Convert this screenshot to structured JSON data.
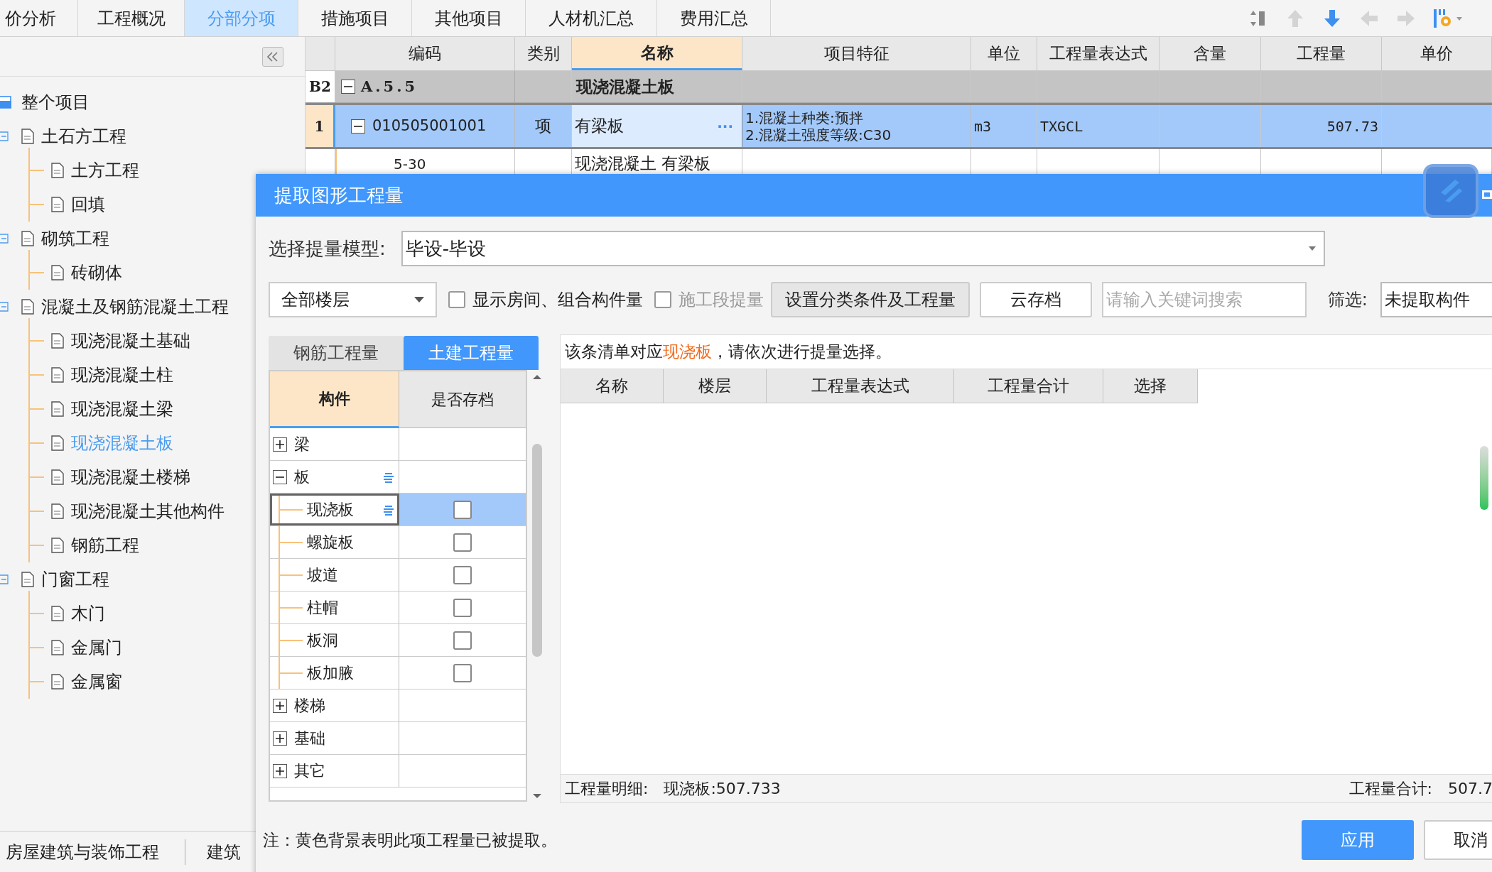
{
  "tabs": [
    {
      "label": "价分析",
      "selected": false
    },
    {
      "label": "工程概况",
      "selected": false
    },
    {
      "label": "分部分项",
      "selected": true
    },
    {
      "label": "措施项目",
      "selected": false
    },
    {
      "label": "其他项目",
      "selected": false
    },
    {
      "label": "人材机汇总",
      "selected": false
    },
    {
      "label": "费用汇总",
      "selected": false
    }
  ],
  "toolbar": [
    {
      "kind": "sort",
      "disabled": false
    },
    {
      "kind": "up",
      "disabled": true
    },
    {
      "kind": "down",
      "disabled": false
    },
    {
      "kind": "left",
      "disabled": true
    },
    {
      "kind": "right",
      "disabled": true
    },
    {
      "kind": "settings",
      "disabled": false
    }
  ],
  "tree": {
    "label": "整个项目",
    "selected": false,
    "children": [
      {
        "label": "土石方工程",
        "selected": false,
        "expanded": true,
        "children": [
          {
            "label": "土方工程",
            "selected": false
          },
          {
            "label": "回填",
            "selected": false
          }
        ]
      },
      {
        "label": "砌筑工程",
        "selected": false,
        "expanded": true,
        "children": [
          {
            "label": "砖砌体",
            "selected": false
          }
        ]
      },
      {
        "label": "混凝土及钢筋混凝土工程",
        "selected": false,
        "expanded": true,
        "children": [
          {
            "label": "现浇混凝土基础",
            "selected": false
          },
          {
            "label": "现浇混凝土柱",
            "selected": false
          },
          {
            "label": "现浇混凝土梁",
            "selected": false
          },
          {
            "label": "现浇混凝土板",
            "selected": true
          },
          {
            "label": "现浇混凝土楼梯",
            "selected": false
          },
          {
            "label": "现浇混凝土其他构件",
            "selected": false
          },
          {
            "label": "钢筋工程",
            "selected": false
          }
        ]
      },
      {
        "label": "门窗工程",
        "selected": false,
        "expanded": true,
        "children": [
          {
            "label": "木门",
            "selected": false
          },
          {
            "label": "金属门",
            "selected": false
          },
          {
            "label": "金属窗",
            "selected": false
          }
        ]
      }
    ]
  },
  "bottom_tabs": [
    "房屋建筑与装饰工程",
    "建筑"
  ],
  "grid": {
    "columns": [
      {
        "label": "编码",
        "selected": false
      },
      {
        "label": "类别",
        "selected": false
      },
      {
        "label": "名称",
        "selected": true
      },
      {
        "label": "项目特征",
        "selected": false
      },
      {
        "label": "单位",
        "selected": false
      },
      {
        "label": "工程量表达式",
        "selected": false
      },
      {
        "label": "含量",
        "selected": false
      },
      {
        "label": "工程量",
        "selected": false
      },
      {
        "label": "单价",
        "selected": false
      }
    ],
    "rows": [
      {
        "kind": "section",
        "index": "B2",
        "expanded": true,
        "code": "A.5.5",
        "name": "现浇混凝土板"
      },
      {
        "kind": "item",
        "index": "1",
        "expanded": true,
        "selected": true,
        "code": "010505001001",
        "type": "项",
        "name": "有梁板",
        "more": "···",
        "features": [
          "1.混凝土种类:预拌",
          "2.混凝土强度等级:C30"
        ],
        "unit": "m3",
        "expression": "TXGCL",
        "quantity": "507.73"
      },
      {
        "kind": "sub",
        "code": "5-30",
        "name": "现浇混凝土 有梁板"
      }
    ]
  },
  "dialog": {
    "title": "提取图形工程量",
    "model": {
      "label": "选择提量模型:",
      "value": "毕设-毕设"
    },
    "floor": {
      "value": "全部楼层"
    },
    "options": [
      {
        "label": "显示房间、组合构件量",
        "checked": false,
        "disabled": false
      },
      {
        "label": "施工段提量",
        "checked": false,
        "disabled": true
      }
    ],
    "buttons": [
      "设置分类条件及工程量",
      "云存档"
    ],
    "search": {
      "placeholder": "请输入关键词搜索"
    },
    "filter": {
      "label": "筛选:",
      "value": "未提取构件"
    },
    "tabs": [
      {
        "label": "钢筋工程量",
        "selected": false
      },
      {
        "label": "土建工程量",
        "selected": true
      }
    ],
    "components": {
      "columns": [
        "构件",
        "是否存档"
      ],
      "rows": [
        {
          "label": "梁",
          "expanded": false,
          "marked": false
        },
        {
          "label": "板",
          "expanded": true,
          "marked": true,
          "children": [
            {
              "label": "现浇板",
              "selected": true,
              "checked": false,
              "marked": true
            },
            {
              "label": "螺旋板",
              "selected": false,
              "checked": false,
              "marked": false
            },
            {
              "label": "坡道",
              "selected": false,
              "checked": false,
              "marked": false
            },
            {
              "label": "柱帽",
              "selected": false,
              "checked": false,
              "marked": false
            },
            {
              "label": "板洞",
              "selected": false,
              "checked": false,
              "marked": false
            },
            {
              "label": "板加腋",
              "selected": false,
              "checked": false,
              "marked": false
            }
          ]
        },
        {
          "label": "楼梯",
          "expanded": false,
          "marked": false
        },
        {
          "label": "基础",
          "expanded": false,
          "marked": false
        },
        {
          "label": "其它",
          "expanded": false,
          "marked": false
        }
      ]
    },
    "message": {
      "before": "该条清单对应",
      "highlight": "现浇板",
      "after": "，请依次进行提量选择。"
    },
    "result_columns": [
      "名称",
      "楼层",
      "工程量表达式",
      "工程量合计",
      "选择"
    ],
    "detail": {
      "label": "工程量明细:",
      "value": "现浇板:507.733"
    },
    "total": {
      "label": "工程量合计:",
      "value": "507.7"
    },
    "note": "注：黄色背景表明此项工程量已被提取。",
    "footer_buttons": [
      {
        "label": "应用",
        "primary": true
      },
      {
        "label": "取消",
        "primary": false
      }
    ]
  }
}
